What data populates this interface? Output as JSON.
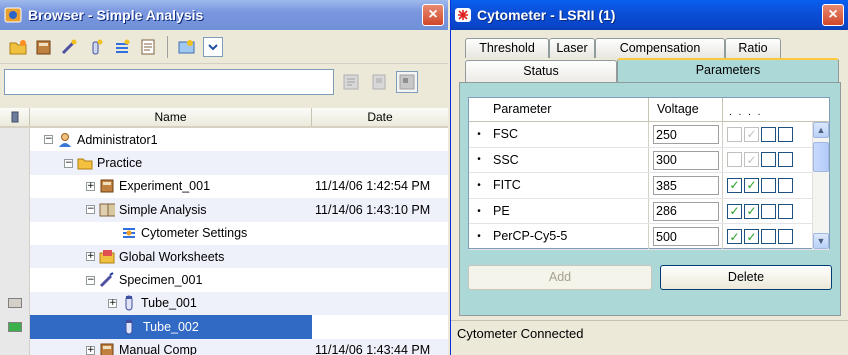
{
  "browser": {
    "title": "Browser - Simple Analysis",
    "close_label": "×",
    "search": {
      "value": "",
      "placeholder": ""
    },
    "columns": {
      "name": "Name",
      "date": "Date"
    },
    "rows": [
      {
        "label": "Administrator1",
        "date": "",
        "icon": "user-icon",
        "expander": "−"
      },
      {
        "label": "Practice",
        "date": "",
        "icon": "folder-icon",
        "expander": "−"
      },
      {
        "label": "Experiment_001",
        "date": "11/14/06 1:42:54 PM",
        "icon": "experiment-icon",
        "expander": "+"
      },
      {
        "label": "Simple Analysis",
        "date": "11/14/06 1:43:10 PM",
        "icon": "book-icon",
        "expander": "−"
      },
      {
        "label": "Cytometer Settings",
        "date": "",
        "icon": "cytometer-settings-icon",
        "expander": ""
      },
      {
        "label": "Global Worksheets",
        "date": "",
        "icon": "worksheets-icon",
        "expander": "+"
      },
      {
        "label": "Specimen_001",
        "date": "",
        "icon": "specimen-icon",
        "expander": "−"
      },
      {
        "label": "Tube_001",
        "date": "",
        "icon": "tube-icon",
        "expander": "+"
      },
      {
        "label": "Tube_002",
        "date": "",
        "icon": "tube-icon",
        "expander": ""
      },
      {
        "label": "Manual Comp",
        "date": "11/14/06 1:43:44 PM",
        "icon": "experiment-icon",
        "expander": "+"
      }
    ]
  },
  "cytometer": {
    "title": "Cytometer - LSRII (1)",
    "close_label": "×",
    "tabs_back": [
      "Threshold",
      "Laser",
      "Compensation",
      "Ratio"
    ],
    "tabs_front": [
      "Status",
      "Parameters"
    ],
    "active_tab": "Parameters",
    "table": {
      "headers": {
        "parameter": "Parameter",
        "voltage": "Voltage",
        "checks": ". . . ."
      },
      "rows": [
        {
          "bullet": "•",
          "parameter": "FSC",
          "voltage": "250",
          "checks": [
            false,
            true,
            false,
            false
          ],
          "first_two_disabled": true
        },
        {
          "bullet": "•",
          "parameter": "SSC",
          "voltage": "300",
          "checks": [
            false,
            true,
            false,
            false
          ],
          "first_two_disabled": true
        },
        {
          "bullet": "•",
          "parameter": "FITC",
          "voltage": "385",
          "checks": [
            true,
            true,
            false,
            false
          ],
          "first_two_disabled": false
        },
        {
          "bullet": "•",
          "parameter": "PE",
          "voltage": "286",
          "checks": [
            true,
            true,
            false,
            false
          ],
          "first_two_disabled": false
        },
        {
          "bullet": "•",
          "parameter": "PerCP-Cy5-5",
          "voltage": "500",
          "checks": [
            true,
            true,
            false,
            false
          ],
          "first_two_disabled": false
        }
      ]
    },
    "buttons": {
      "add": "Add",
      "delete": "Delete"
    },
    "status": "Cytometer Connected"
  },
  "colors": {
    "selection": "#316ac5",
    "panel": "#add8d8",
    "active_tab_accent": "#ffc83d",
    "check_green": "#21a121"
  }
}
